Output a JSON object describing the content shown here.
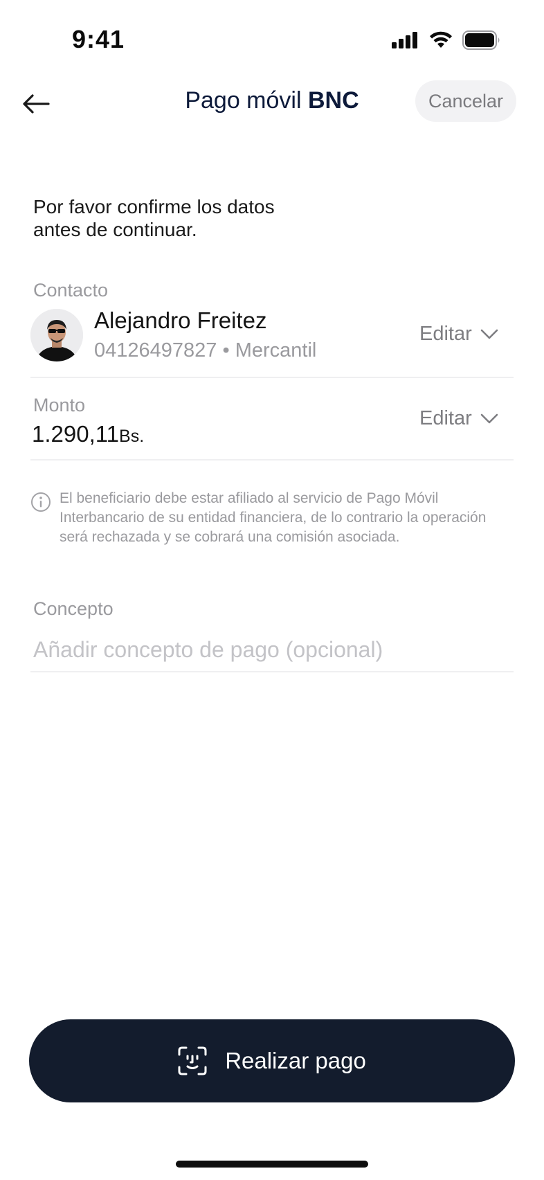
{
  "status_bar": {
    "time": "9:41"
  },
  "header": {
    "title_prefix": "Pago móvil",
    "title_brand": "BNC",
    "cancel_label": "Cancelar"
  },
  "intro_text": "Por favor confirme los datos antes de continuar.",
  "contact": {
    "label": "Contacto",
    "name": "Alejandro Freitez",
    "phone": "04126497827",
    "separator": "•",
    "bank": "Mercantil",
    "edit_label": "Editar"
  },
  "amount": {
    "label": "Monto",
    "value": "1.290,11",
    "currency": "Bs.",
    "edit_label": "Editar"
  },
  "info_note": "El beneficiario debe estar afiliado al servicio de Pago Móvil Interbancario de su entidad financiera, de lo contrario la operación será rechazada y se cobrará una comisión asociada.",
  "concept": {
    "label": "Concepto",
    "placeholder": "Añadir concepto de pago (opcional)",
    "value": ""
  },
  "pay_button": {
    "label": "Realizar pago",
    "icon": "face-id-icon"
  },
  "colors": {
    "brand_navy": "#131c2d",
    "title_navy": "#0d1a3a",
    "muted_text": "#9a9a9e"
  }
}
